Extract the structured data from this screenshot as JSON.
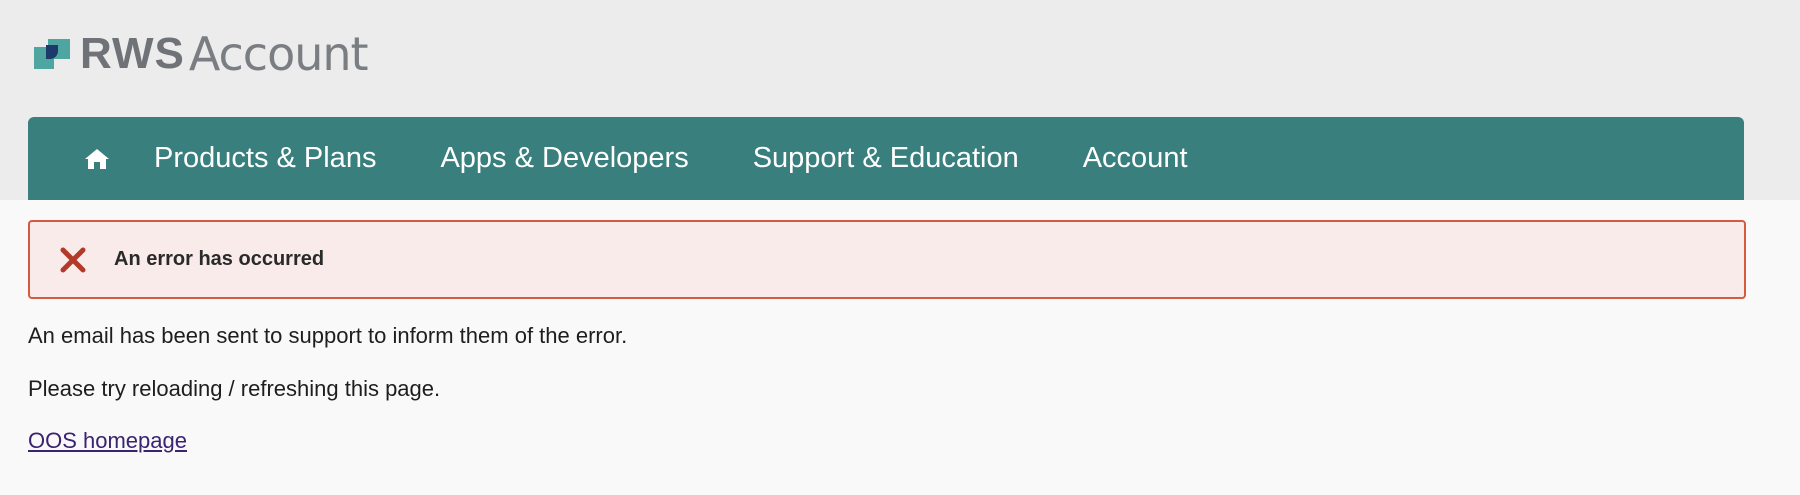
{
  "brand": {
    "logo_strong": "RWS",
    "logo_light": "Account"
  },
  "nav": {
    "home_icon": "home-icon",
    "items": [
      {
        "label": "Products & Plans"
      },
      {
        "label": "Apps & Developers"
      },
      {
        "label": "Support & Education"
      },
      {
        "label": "Account"
      }
    ]
  },
  "alert": {
    "icon": "close-x-icon",
    "title": "An error has occurred"
  },
  "messages": {
    "line1": "An email has been sent to support to inform them of the error.",
    "line2": "Please try reloading / refreshing this page."
  },
  "links": {
    "homepage": "OOS homepage"
  },
  "colors": {
    "nav_bg": "#387f7d",
    "alert_border": "#d65a3f",
    "alert_bg": "#f8ebe9",
    "error_icon": "#b23a2a",
    "link": "#3a2370",
    "header_bg": "#ececec"
  }
}
